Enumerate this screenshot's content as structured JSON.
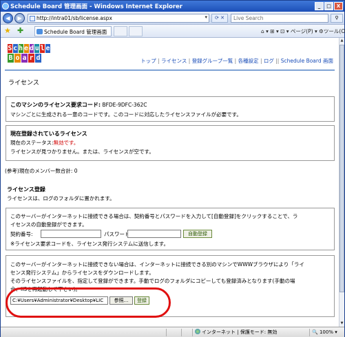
{
  "window": {
    "title": "Schedule Board 管理画面 - Windows Internet Explorer",
    "min": "_",
    "max": "□",
    "close": "X"
  },
  "address": {
    "url": "http://intra01/sb/license.aspx",
    "search_placeholder": "Live Search",
    "back": "◀",
    "forward": "▶",
    "refresh": "⟳ ✕"
  },
  "favbar": {
    "tab_title": "Schedule Board 管理画面",
    "tools": "⌂ ▾ ⊞ ▾ ⊡ ▾ ページ(P) ▾ ⚙ツール(O) ▾ »"
  },
  "logo": {
    "line1": [
      "S",
      "c",
      "h",
      "e",
      "d",
      "u",
      "l",
      "e"
    ],
    "line2": [
      "B",
      "o",
      "a",
      "r",
      "d"
    ],
    "colors1": [
      "#d9261c",
      "#2a63c8",
      "#3a9a2b",
      "#e68a00",
      "#8a2cb8",
      "#1a8fa8",
      "#d9261c",
      "#2a63c8"
    ],
    "colors2": [
      "#3a9a2b",
      "#e68a00",
      "#8a2cb8",
      "#d9261c",
      "#2a63c8"
    ]
  },
  "nav": {
    "items": [
      "トップ",
      "ライセンス",
      "登録グループ一覧",
      "各種設定",
      "ログ",
      "Schedule Board 画面"
    ]
  },
  "page_title": "ライセンス",
  "request_code": {
    "label": "このマシンのライセンス要求コード:",
    "code": "BFDE-9DFC-362C",
    "note": "マシンごとに生成される一意のコードです。このコードに対応したライセンスファイルが必要です。"
  },
  "registered": {
    "heading": "現在登録されているライセンス",
    "status_label": "現在のステータス:",
    "status_value": "無効です。",
    "message": "ライセンスが見つかりません。または、ライセンスが空です。"
  },
  "member_total": "(参考)現在のメンバー数合計: 0",
  "registration": {
    "heading": "ライセンス登録",
    "desc": "ライセンスは、ログのフォルダに置かれます。"
  },
  "online": {
    "line1": "このサーバーがインターネットに接続できる場合は、契約番号とパスワードを入力して[自動登録]をクリックすることで、ラ",
    "line2": "イセンスの自動登録ができます。",
    "contract_label": "契約番号:",
    "password_label": "パスワード:",
    "auto_button": "自動登録",
    "note": "※ライセンス要求コードを、ライセンス発行システムに送信します。"
  },
  "offline": {
    "line1": "このサーバーがインターネットに接続できない場合は、インターネットに接続できる別のマシンでWWWブラウザにより「ライ",
    "line2": "センス発行システム」からライセンスをダウンロードします。",
    "line3": "そのライセンスファイルを、指定して登録ができます。手動でログのフォルダにコピーしても登録済みとなります(手動の場",
    "line4": "合、IISを再起動して下さい)。",
    "file_path": "C:¥Users¥Administrator¥Desktop¥LIC",
    "browse_button": "参照...",
    "register_button": "登録"
  },
  "statusbar": {
    "zone": "インターネット | 保護モード: 無効",
    "zoom": "100%"
  }
}
